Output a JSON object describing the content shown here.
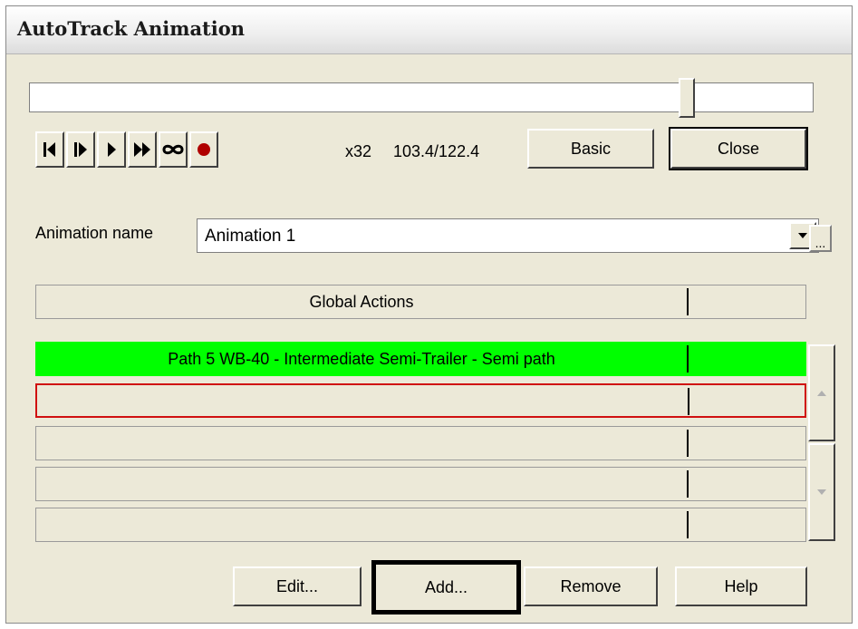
{
  "window": {
    "title": "AutoTrack Animation"
  },
  "playback": {
    "progress_fraction": 0.86,
    "speed": "x32",
    "time": "103.4/122.4",
    "controls": [
      "skip-to-start",
      "step-forward",
      "play",
      "fast-forward",
      "loop",
      "record"
    ]
  },
  "buttons": {
    "basic": "Basic",
    "close": "Close",
    "ellipsis": "...",
    "edit": "Edit...",
    "add": "Add...",
    "remove": "Remove",
    "help": "Help"
  },
  "animation": {
    "label": "Animation name",
    "value": "Animation 1"
  },
  "actions": {
    "header": "Global Actions",
    "rows": [
      {
        "text": "Path 5 WB-40 - Intermediate Semi-Trailer - Semi path",
        "state": "active"
      },
      {
        "text": "",
        "state": "selected"
      },
      {
        "text": "",
        "state": "normal"
      },
      {
        "text": "",
        "state": "normal"
      },
      {
        "text": "",
        "state": "normal"
      }
    ]
  },
  "colors": {
    "active_row": "#00ff00",
    "selected_border": "#d01010",
    "record": "#b00000",
    "dialog_bg": "#ece9d8"
  }
}
